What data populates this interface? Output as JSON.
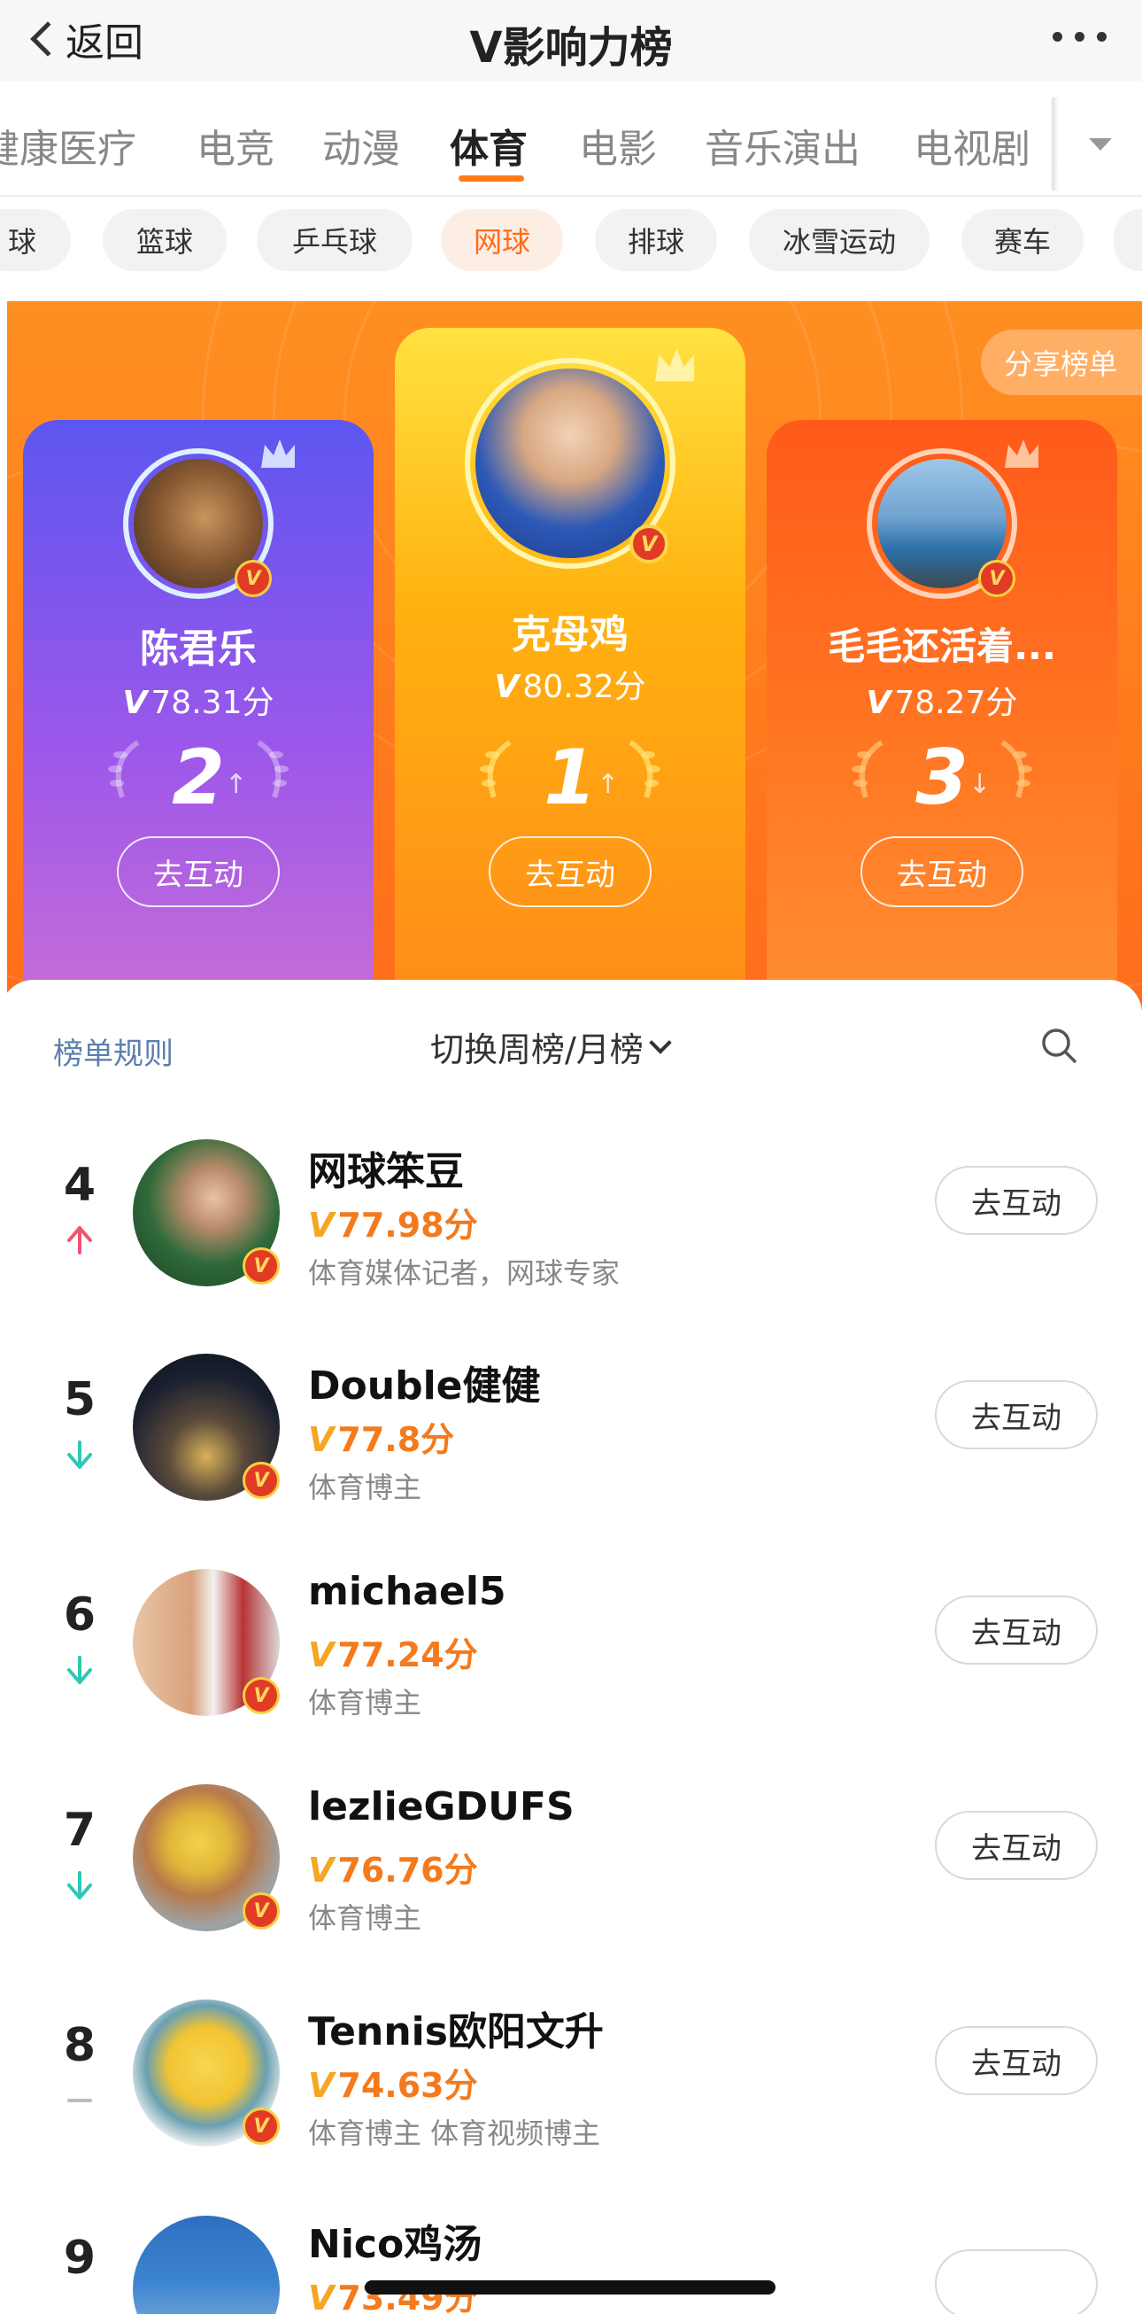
{
  "header": {
    "back_label": "返回",
    "title": "V影响力榜"
  },
  "category_tabs": [
    {
      "label": "健康医疗"
    },
    {
      "label": "电竞"
    },
    {
      "label": "动漫"
    },
    {
      "label": "体育",
      "active": true
    },
    {
      "label": "电影"
    },
    {
      "label": "音乐演出"
    },
    {
      "label": "电视剧"
    }
  ],
  "sub_tabs": [
    {
      "label": "球"
    },
    {
      "label": "篮球"
    },
    {
      "label": "乒乓球"
    },
    {
      "label": "网球",
      "active": true
    },
    {
      "label": "排球"
    },
    {
      "label": "冰雪运动"
    },
    {
      "label": "赛车"
    }
  ],
  "banner": {
    "share_label": "分享榜单"
  },
  "top3": [
    {
      "rank": "2",
      "name": "陈君乐",
      "v": "V",
      "score": "78.31分",
      "trend": "up",
      "trend_glyph": "↑",
      "button": "去互动"
    },
    {
      "rank": "1",
      "name": "克母鸡",
      "v": "V",
      "score": "80.32分",
      "trend": "up",
      "trend_glyph": "↑",
      "button": "去互动"
    },
    {
      "rank": "3",
      "name": "毛毛还活着...",
      "v": "V",
      "score": "78.27分",
      "trend": "down",
      "trend_glyph": "↓",
      "button": "去互动"
    }
  ],
  "list_header": {
    "rules_label": "榜单规则",
    "switch_label": "切换周榜/月榜"
  },
  "list": [
    {
      "rank": "4",
      "trend": "up",
      "name": "网球笨豆",
      "v": "V",
      "score": "77.98分",
      "desc": "体育媒体记者，网球专家",
      "button": "去互动"
    },
    {
      "rank": "5",
      "trend": "down",
      "name": "Double健健",
      "v": "V",
      "score": "77.8分",
      "desc": "体育博主",
      "button": "去互动"
    },
    {
      "rank": "6",
      "trend": "down",
      "name": "michael5",
      "v": "V",
      "score": "77.24分",
      "desc": "体育博主",
      "button": "去互动"
    },
    {
      "rank": "7",
      "trend": "down",
      "name": "lezlieGDUFS",
      "v": "V",
      "score": "76.76分",
      "desc": "体育博主",
      "button": "去互动"
    },
    {
      "rank": "8",
      "trend": "same",
      "name": "Tennis欧阳文升",
      "v": "V",
      "score": "74.63分",
      "desc": "体育博主 体育视频博主",
      "button": "去互动"
    },
    {
      "rank": "9",
      "trend": "",
      "name": "Nico鸡汤",
      "v": "V",
      "score": "73.49分",
      "desc": "",
      "button": ""
    }
  ],
  "colors": {
    "accent": "#ff7a1a",
    "score": "#f37a1d",
    "trend_up": "#f0566b",
    "trend_down": "#2fc7b5",
    "card1": "#ffb20f",
    "card2": "#7d57ee",
    "card3": "#ff6320",
    "badge_red": "#e23b25"
  }
}
